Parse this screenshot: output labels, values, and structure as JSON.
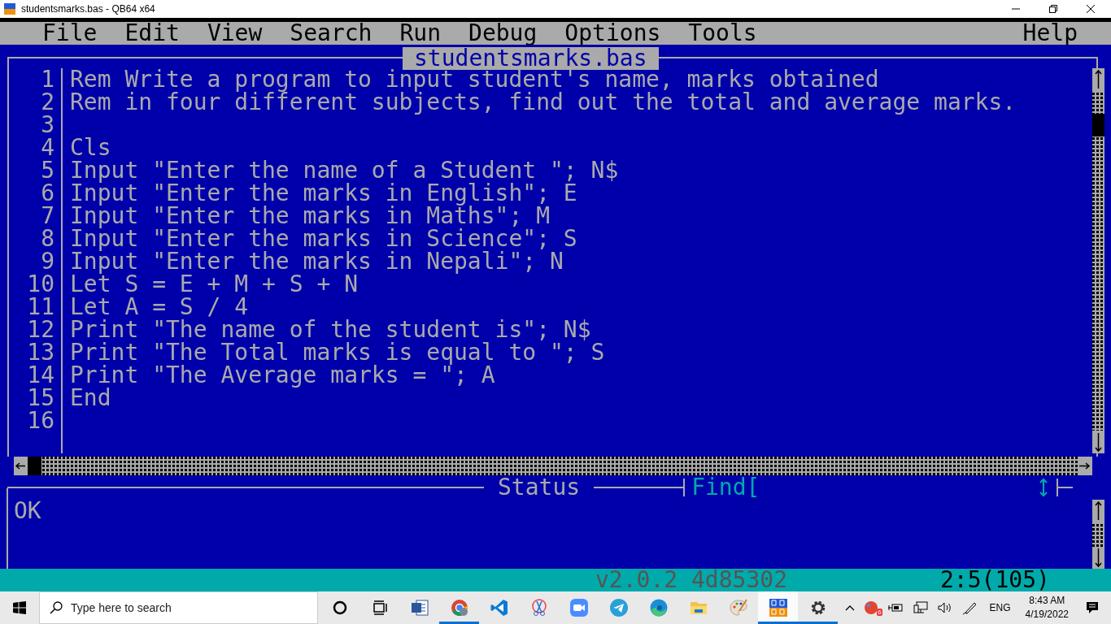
{
  "window": {
    "title": "studentsmarks.bas - QB64 x64"
  },
  "menu": [
    {
      "label": "File"
    },
    {
      "label": "Edit"
    },
    {
      "label": "View"
    },
    {
      "label": "Search"
    },
    {
      "label": "Run"
    },
    {
      "label": "Debug"
    },
    {
      "label": "Options"
    },
    {
      "label": "Tools"
    }
  ],
  "help_menu": {
    "label": "Help"
  },
  "editor": {
    "title": "studentsmarks.bas",
    "lines": [
      {
        "number": "1",
        "code": "Rem Write a program to input student's name, marks obtained"
      },
      {
        "number": "2",
        "code": "Rem in four different subjects, find out the total and average marks."
      },
      {
        "number": "3"
      },
      {
        "number": "4",
        "code": "Cls"
      },
      {
        "number": "5",
        "code": "Input \"Enter the name of a Student \"; N$"
      },
      {
        "number": "6",
        "code": "Input \"Enter the marks in English\"; E"
      },
      {
        "number": "7",
        "code": "Input \"Enter the marks in Maths\"; M"
      },
      {
        "number": "8",
        "code": "Input \"Enter the marks in Science\"; S"
      },
      {
        "number": "9",
        "code": "Input \"Enter the marks in Nepali\"; N"
      },
      {
        "number": "10",
        "code": "Let S = E + M + S + N"
      },
      {
        "number": "11",
        "code": "Let A = S / 4"
      },
      {
        "number": "12",
        "code": "Print \"The name of the student is\"; N$"
      },
      {
        "number": "13",
        "code": "Print \"The Total marks is equal to \"; S"
      },
      {
        "number": "14",
        "code": "Print \"The Average marks = \"; A"
      },
      {
        "number": "15",
        "code": "End"
      },
      {
        "number": "16"
      }
    ]
  },
  "status": {
    "title": "Status",
    "message": "OK",
    "find": "Find["
  },
  "info_bar": {
    "version": "v2.0.2 4d85302",
    "position": "2:5(105)"
  },
  "taskbar": {
    "search_placeholder": "Type here to search",
    "apps": [
      {
        "kind": "cortana",
        "running": false,
        "selected": false
      },
      {
        "kind": "taskview",
        "running": false,
        "selected": false
      },
      {
        "kind": "word",
        "running": false,
        "selected": false
      },
      {
        "kind": "chrome",
        "running": true,
        "selected": false
      },
      {
        "kind": "vscode",
        "running": false,
        "selected": false
      },
      {
        "kind": "snip",
        "running": false,
        "selected": false
      },
      {
        "kind": "zoom",
        "running": false,
        "selected": false
      },
      {
        "kind": "telegram",
        "running": false,
        "selected": false
      },
      {
        "kind": "edge",
        "running": false,
        "selected": false
      },
      {
        "kind": "explorer",
        "running": false,
        "selected": false
      },
      {
        "kind": "paint",
        "running": false,
        "selected": false
      },
      {
        "kind": "qb64",
        "running": true,
        "selected": true
      },
      {
        "kind": "settings",
        "running": true,
        "selected": false
      }
    ],
    "tray": {
      "badge": "6",
      "language": "ENG",
      "time": "8:43 AM",
      "date": "4/19/2022"
    }
  }
}
